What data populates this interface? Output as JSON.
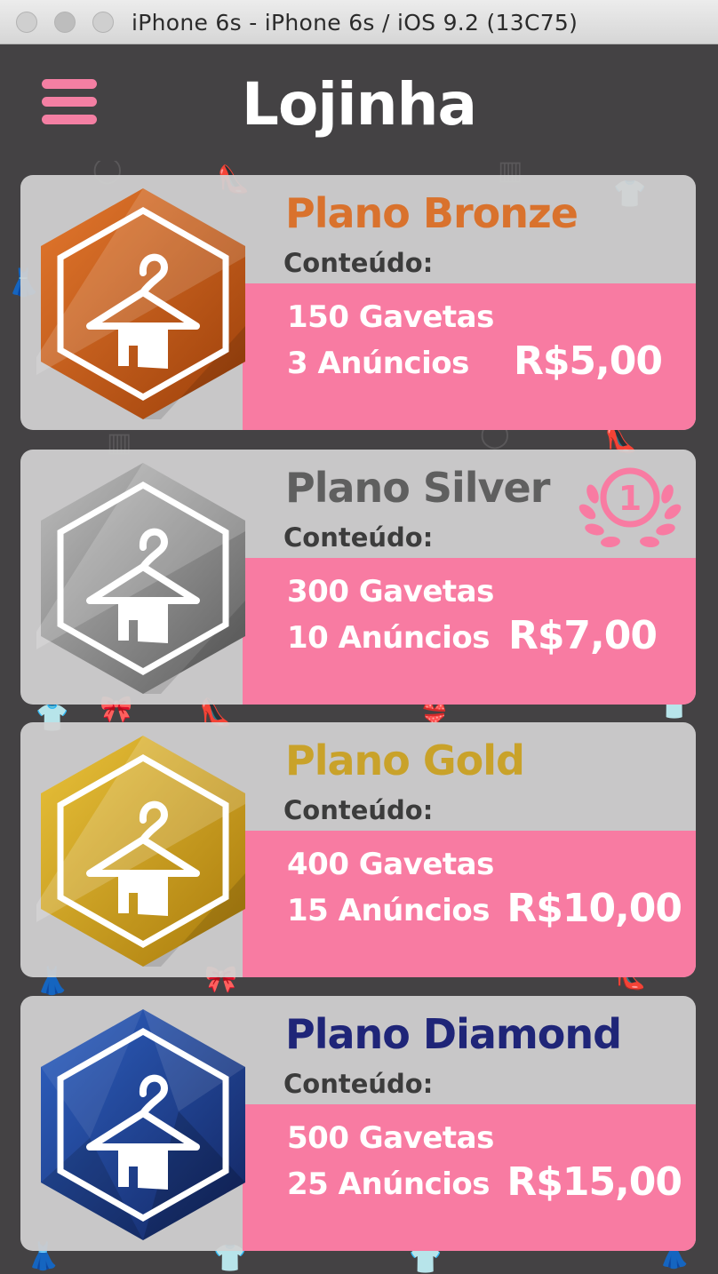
{
  "window": {
    "title": "iPhone 6s - iPhone 6s / iOS 9.2 (13C75)"
  },
  "header": {
    "title": "Lojinha",
    "menu_icon": "hamburger-menu-icon"
  },
  "colors": {
    "accent": "#f87ba2",
    "background": "#444244"
  },
  "plans": [
    {
      "name": "Plano Bronze",
      "name_color": "#d9722d",
      "content_label": "Conteúdo:",
      "drawers": "150 Gavetas",
      "ads": "3 Anúncios",
      "price": "R$5,00",
      "badge": "bronze-hanger-badge-icon"
    },
    {
      "name": "Plano Silver",
      "name_color": "#5f5f5f",
      "content_label": "Conteúdo:",
      "drawers": "300 Gavetas",
      "ads": "10 Anúncios",
      "price": "R$7,00",
      "badge": "silver-hanger-badge-icon",
      "rank": "1"
    },
    {
      "name": "Plano Gold",
      "name_color": "#c9a22a",
      "content_label": "Conteúdo:",
      "drawers": "400 Gavetas",
      "ads": " 15 Anúncios",
      "price": "R$10,00",
      "badge": "gold-hanger-badge-icon"
    },
    {
      "name": "Plano Diamond",
      "name_color": "#1f2578",
      "content_label": "Conteúdo:",
      "drawers": "500 Gavetas",
      "ads": "25 Anúncios",
      "price": "R$15,00",
      "badge": "diamond-hanger-badge-icon"
    }
  ]
}
